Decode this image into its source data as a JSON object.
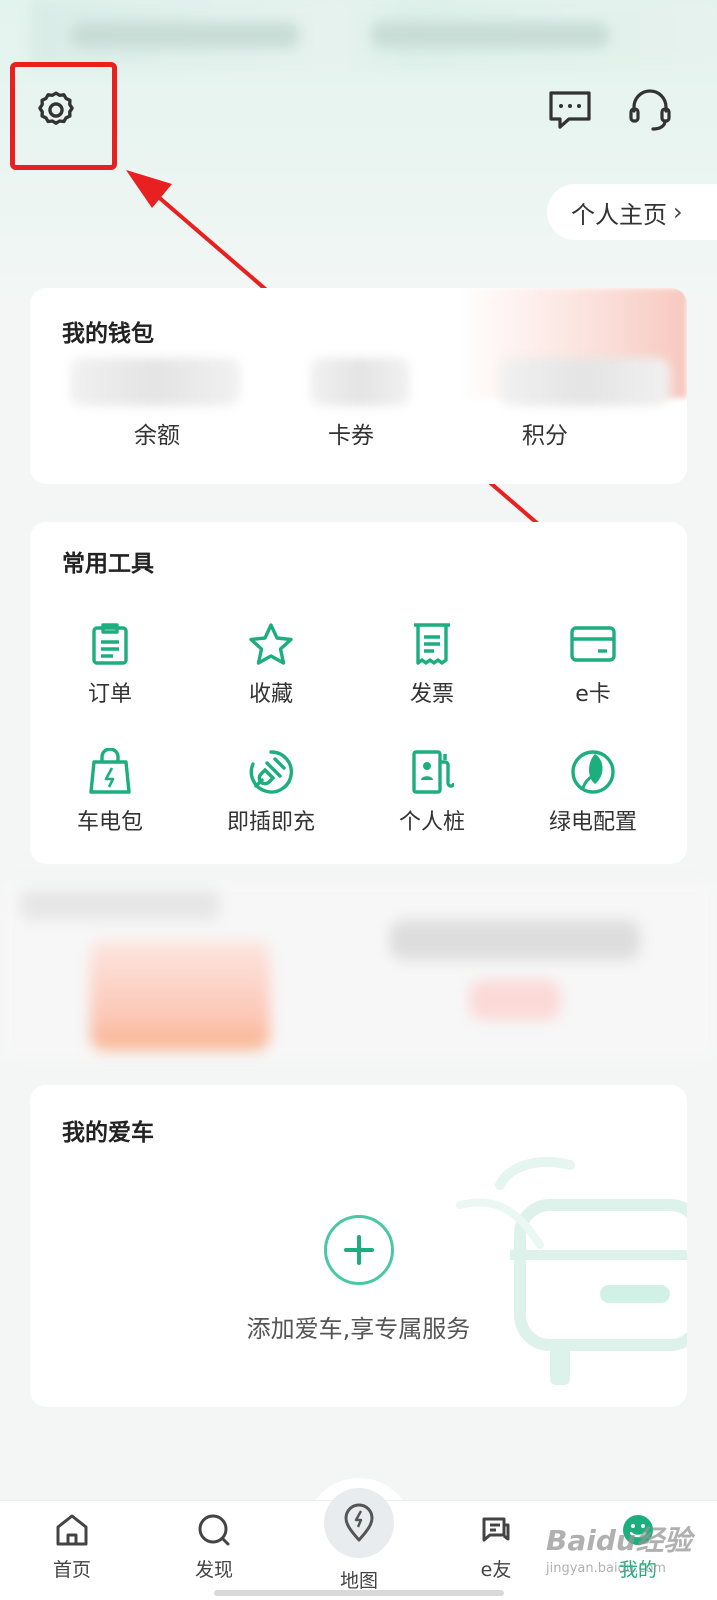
{
  "header": {
    "personal_home_label": "个人主页",
    "personal_home_chevron": "›",
    "icons": [
      "gear-icon",
      "message-icon",
      "headset-icon"
    ]
  },
  "wallet": {
    "title": "我的钱包",
    "items": [
      {
        "label": "余额"
      },
      {
        "label": "卡券"
      },
      {
        "label": "积分"
      }
    ]
  },
  "tools": {
    "title": "常用工具",
    "items": [
      {
        "label": "订单",
        "icon": "clipboard-icon"
      },
      {
        "label": "收藏",
        "icon": "star-icon"
      },
      {
        "label": "发票",
        "icon": "receipt-icon"
      },
      {
        "label": "e卡",
        "icon": "card-icon"
      },
      {
        "label": "车电包",
        "icon": "battery-bag-icon"
      },
      {
        "label": "即插即充",
        "icon": "plug-icon"
      },
      {
        "label": "个人桩",
        "icon": "charger-icon"
      },
      {
        "label": "绿电配置",
        "icon": "leaf-icon"
      }
    ]
  },
  "car": {
    "title": "我的爱车",
    "add_text": "添加爱车,享专属服务"
  },
  "tabbar": {
    "items": [
      {
        "label": "首页",
        "icon": "home-icon"
      },
      {
        "label": "发现",
        "icon": "discover-icon"
      },
      {
        "label": "地图",
        "icon": "map-pin-icon"
      },
      {
        "label": "e友",
        "icon": "chat-icon"
      },
      {
        "label": "我的",
        "icon": "smile-icon",
        "active": true
      }
    ]
  },
  "watermark": {
    "text": "Baidu经验",
    "sub": "jingyan.baidu.com"
  },
  "colors": {
    "accent": "#1dae7e",
    "highlight": "#e8201f",
    "background": "#f3f6f5"
  }
}
